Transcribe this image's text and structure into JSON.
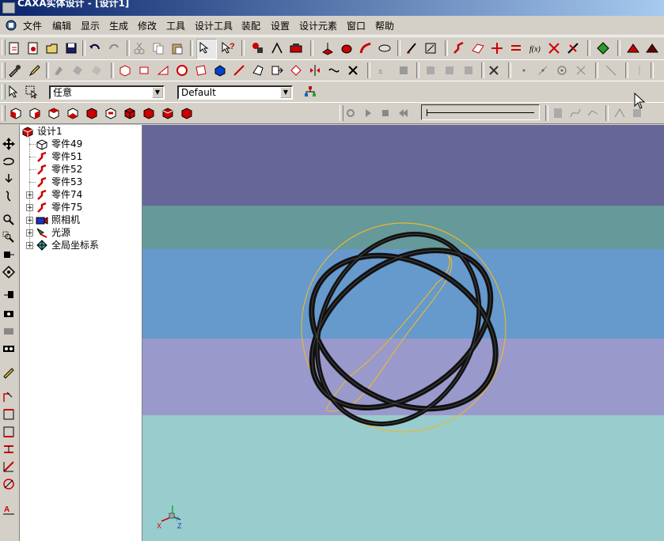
{
  "window": {
    "title": "CAXA实体设计 - [设计1]"
  },
  "menu": [
    "文件",
    "编辑",
    "显示",
    "生成",
    "修改",
    "工具",
    "设计工具",
    "装配",
    "设置",
    "设计元素",
    "窗口",
    "帮助"
  ],
  "toolbar3": {
    "filter_value": "任意",
    "style_value": "Default"
  },
  "tree": {
    "root": "设计1",
    "items": [
      {
        "label": "零件49",
        "icon": "part-icon",
        "expandable": false
      },
      {
        "label": "零件51",
        "icon": "curve-icon",
        "expandable": false
      },
      {
        "label": "零件52",
        "icon": "curve-icon",
        "expandable": false
      },
      {
        "label": "零件53",
        "icon": "curve-icon",
        "expandable": false
      },
      {
        "label": "零件74",
        "icon": "curve-icon",
        "expandable": true
      },
      {
        "label": "零件75",
        "icon": "curve-icon",
        "expandable": true
      },
      {
        "label": "照相机",
        "icon": "camera-icon",
        "expandable": true
      },
      {
        "label": "光源",
        "icon": "light-icon",
        "expandable": true
      },
      {
        "label": "全局坐标系",
        "icon": "axes-icon",
        "expandable": true
      }
    ]
  },
  "triad": {
    "x": "X",
    "y": "Y",
    "z": "Z"
  },
  "colors": {
    "band1": "#666699",
    "band2": "#669999",
    "band3": "#6699cc",
    "band4": "#9999cc",
    "band5": "#99cccc",
    "wire": "#111111",
    "selection": "#e8b830"
  }
}
